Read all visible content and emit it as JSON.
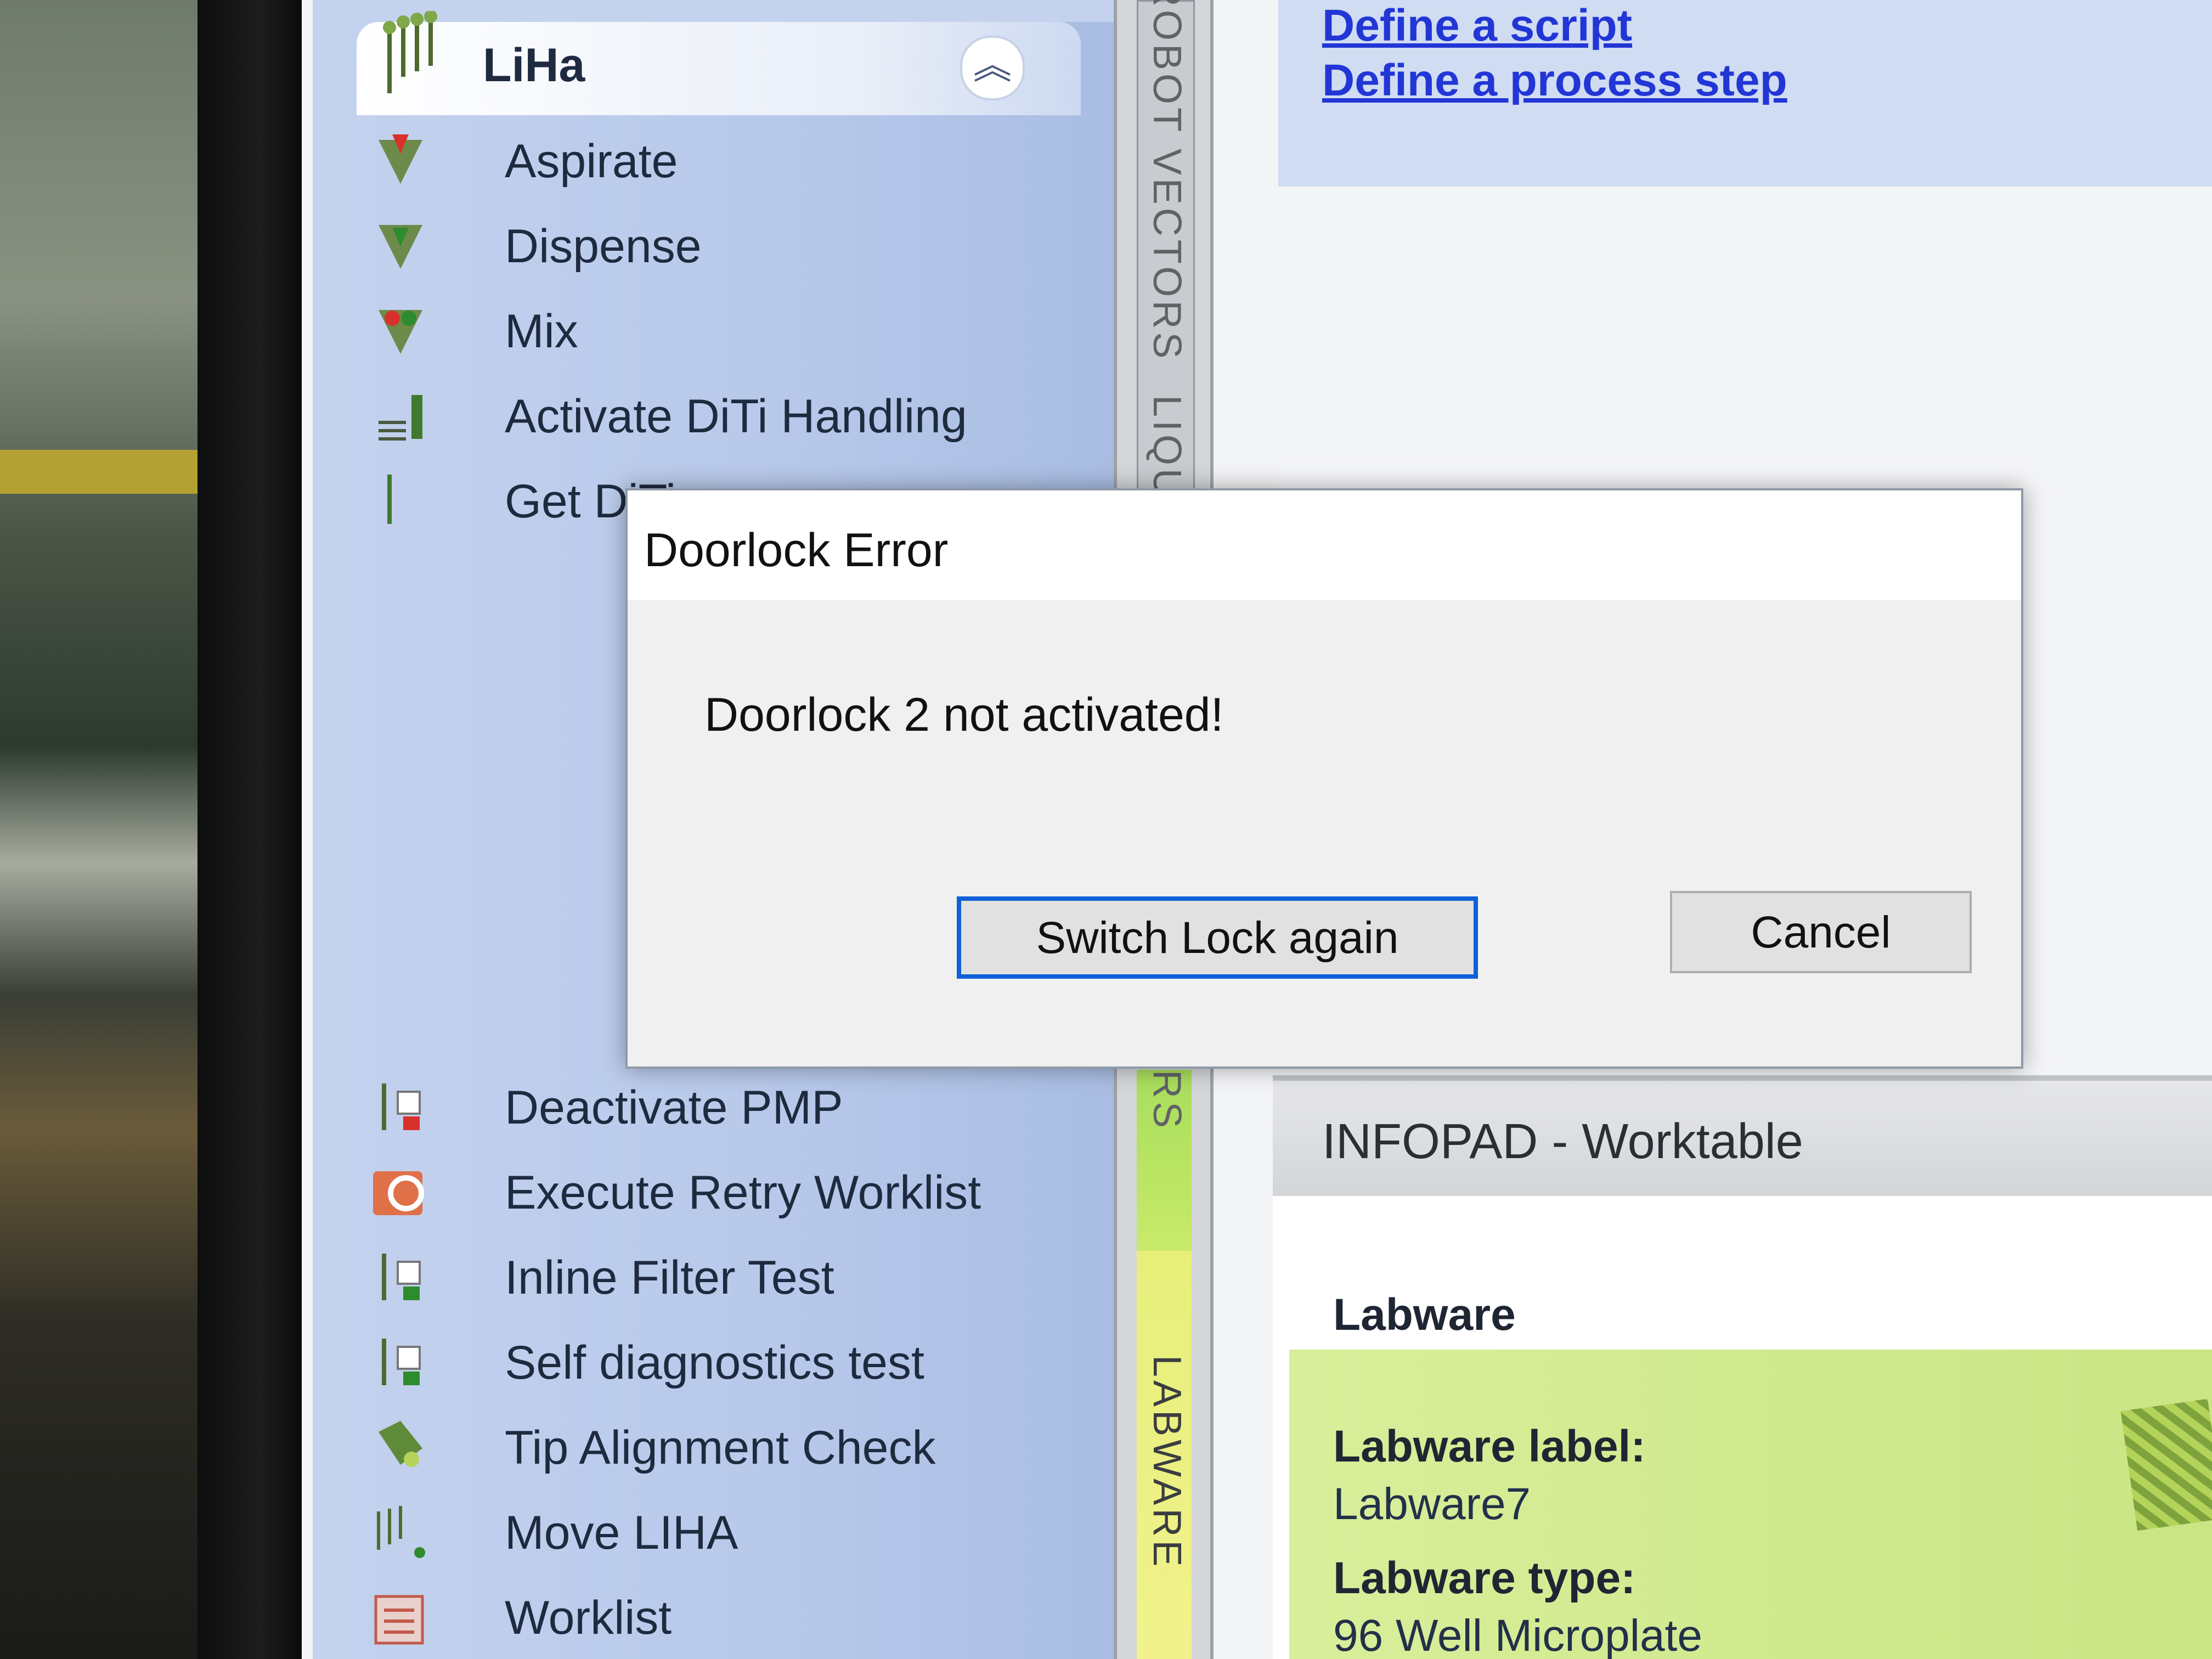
{
  "control_bar": {
    "group_title": "LiHa",
    "items": [
      {
        "label": "Aspirate",
        "icon": "aspirate-icon"
      },
      {
        "label": "Dispense",
        "icon": "dispense-icon"
      },
      {
        "label": "Mix",
        "icon": "mix-icon"
      },
      {
        "label": "Activate DiTi Handling",
        "icon": "diti-handling-icon"
      },
      {
        "label": "Get DiTis",
        "icon": "get-ditis-icon"
      },
      {
        "label": "Deactivate PMP",
        "icon": "deactivate-pmp-icon"
      },
      {
        "label": "Execute Retry Worklist",
        "icon": "retry-worklist-icon"
      },
      {
        "label": "Inline Filter Test",
        "icon": "inline-filter-test-icon"
      },
      {
        "label": "Self diagnostics test",
        "icon": "self-diagnostics-icon"
      },
      {
        "label": "Tip Alignment Check",
        "icon": "tip-alignment-icon"
      },
      {
        "label": "Move LIHA",
        "icon": "move-liha-icon"
      },
      {
        "label": "Worklist",
        "icon": "worklist-icon"
      }
    ]
  },
  "side_tabs": {
    "upper_a": "ROBOT VECTORS",
    "upper_b": "LIQUID CLASSES",
    "lower_a": "RS",
    "lower_b": "LABWARE"
  },
  "help_panel": {
    "links": [
      "Define a script",
      "Define a process step"
    ]
  },
  "infopad": {
    "title": "INFOPAD - Worktable",
    "section": "Labware",
    "label_caption": "Labware label:",
    "label_value": "Labware7",
    "type_caption": "Labware type:",
    "type_value": "96 Well Microplate"
  },
  "dialog": {
    "title": "Doorlock Error",
    "message": "Doorlock 2 not activated!",
    "primary_button": "Switch Lock again",
    "cancel_button": "Cancel"
  },
  "colors": {
    "control_bar_bg": "#b7c8ea",
    "link": "#2236d6",
    "primary_button_border": "#0e5fd8",
    "labware_green": "#c9e584"
  }
}
